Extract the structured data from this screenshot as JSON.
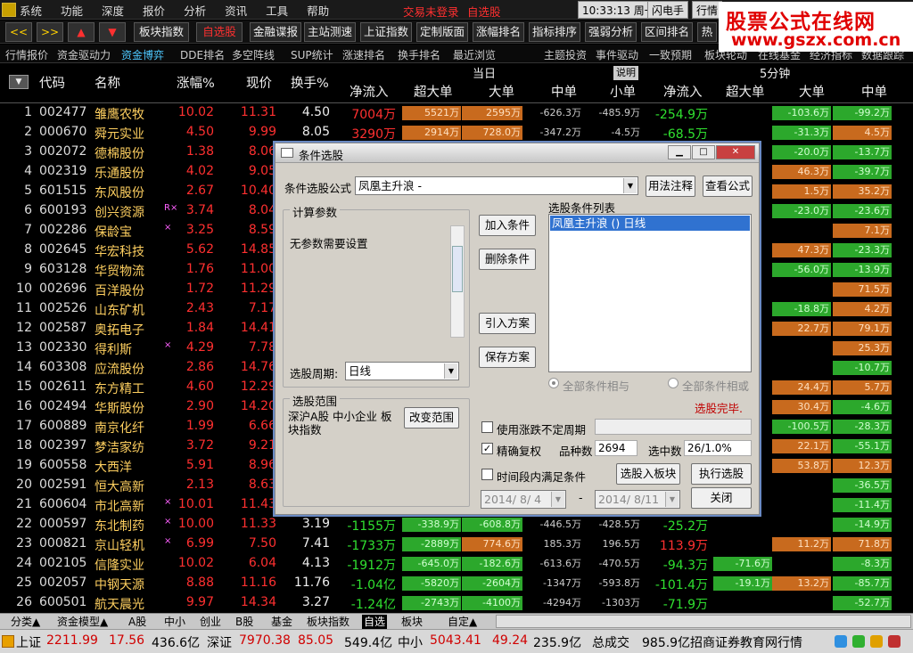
{
  "menu": [
    "系统",
    "功能",
    "深度",
    "报价",
    "分析",
    "资讯",
    "工具",
    "帮助"
  ],
  "login_status": "交易未登录",
  "my_pick": "自选股",
  "clock": "10:33:13 周一",
  "flash_label": "闪电手",
  "quote_label": "行情",
  "watermark": {
    "line1": "股票公式在线网",
    "line2": "www.gszx.com.cn"
  },
  "toolbar": {
    "nav": [
      "<<",
      ">>",
      "▲",
      "▼"
    ],
    "buttons": [
      "板块指数",
      "自选股",
      "金融谍报",
      "主站测速",
      "上证指数",
      "定制版面",
      "涨幅排名",
      "指标排序",
      "强弱分析",
      "区间排名",
      "热"
    ],
    "active": "自选股"
  },
  "subtabs": [
    "行情报价",
    "资金驱动力",
    "资金博弈",
    "DDE排名",
    "多空阵线",
    "SUP统计",
    "涨速排名",
    "换手排名",
    "最近浏览",
    "主题投资",
    "事件驱动",
    "一致预期",
    "板块轮动",
    "在线基金",
    "经济指标",
    "数据跟踪"
  ],
  "subtab_active": "资金博弈",
  "table": {
    "group_today": "当日",
    "explain": "说明",
    "group_5min": "5分钟",
    "columns": [
      "代码",
      "名称",
      "涨幅%",
      "现价",
      "换手%",
      "净流入",
      "超大单",
      "大单",
      "中单",
      "小单",
      "净流入",
      "超大单",
      "大单",
      "中单"
    ],
    "rows": [
      {
        "no": "1",
        "code": "002477",
        "name": "雏鹰农牧",
        "mark": "",
        "chg": "10.02",
        "price": "11.31",
        "turn": "4.50",
        "net": "7004万",
        "xl": "5521万",
        "xlu": true,
        "l": "2595万",
        "lu": true,
        "m": "-626.3万",
        "s": "-485.9万",
        "net5": "-254.9万",
        "net5u": false,
        "l5": "-103.6万",
        "l5u": false,
        "m5": "-99.2万",
        "m5u": false
      },
      {
        "no": "2",
        "code": "000670",
        "name": "舜元实业",
        "mark": "",
        "chg": "4.50",
        "price": "9.99",
        "turn": "8.05",
        "net": "3290万",
        "xl": "2914万",
        "xlu": true,
        "l": "728.0万",
        "lu": true,
        "m": "-347.2万",
        "s": "-4.5万",
        "net5": "-68.5万",
        "net5u": false,
        "l5": "-31.3万",
        "l5u": false,
        "m5": "4.5万",
        "m5u": true
      },
      {
        "no": "3",
        "code": "002072",
        "name": "德棉股份",
        "mark": "",
        "chg": "1.38",
        "price": "8.06",
        "turn": "",
        "net": "",
        "xl": "",
        "l": "",
        "m": "",
        "s": "",
        "net5": "",
        "l5": "-20.0万",
        "l5u": false,
        "m5": "-13.7万",
        "m5u": false
      },
      {
        "no": "4",
        "code": "002319",
        "name": "乐通股份",
        "mark": "",
        "chg": "4.02",
        "price": "9.05",
        "turn": "",
        "net": "",
        "xl": "",
        "l": "",
        "m": "",
        "s": "",
        "net5": "",
        "l5": "46.3万",
        "l5u": true,
        "m5": "-39.7万",
        "m5u": false
      },
      {
        "no": "5",
        "code": "601515",
        "name": "东风股份",
        "mark": "",
        "chg": "2.67",
        "price": "10.40",
        "turn": "",
        "net": "",
        "xl": "",
        "l": "",
        "m": "",
        "s": "",
        "net5": "",
        "l5": "1.5万",
        "l5u": true,
        "m5": "35.2万",
        "m5u": true
      },
      {
        "no": "6",
        "code": "600193",
        "name": "创兴资源",
        "mark": "R×",
        "chg": "3.74",
        "price": "8.04",
        "turn": "",
        "net": "",
        "xl": "",
        "l": "",
        "m": "",
        "s": "",
        "net5": "",
        "l5": "-23.0万",
        "l5u": false,
        "m5": "-23.6万",
        "m5u": false
      },
      {
        "no": "7",
        "code": "002286",
        "name": "保龄宝",
        "mark": "×",
        "chg": "3.25",
        "price": "8.59",
        "turn": "",
        "net": "",
        "xl": "",
        "l": "",
        "m": "",
        "s": "",
        "net5": "",
        "l5": "",
        "m5": "7.1万",
        "m5u": true
      },
      {
        "no": "8",
        "code": "002645",
        "name": "华宏科技",
        "mark": "",
        "chg": "5.62",
        "price": "14.85",
        "turn": "",
        "net": "",
        "xl": "",
        "l": "",
        "m": "",
        "s": "",
        "net5": "",
        "l5": "47.3万",
        "l5u": true,
        "m5": "-23.3万",
        "m5u": false
      },
      {
        "no": "9",
        "code": "603128",
        "name": "华贸物流",
        "mark": "",
        "chg": "1.76",
        "price": "11.00",
        "turn": "",
        "net": "",
        "xl": "",
        "l": "",
        "m": "",
        "s": "",
        "net5": "",
        "l5": "-56.0万",
        "l5u": false,
        "m5": "-13.9万",
        "m5u": false
      },
      {
        "no": "10",
        "code": "002696",
        "name": "百洋股份",
        "mark": "",
        "chg": "1.72",
        "price": "11.29",
        "turn": "",
        "net": "",
        "xl": "",
        "l": "",
        "m": "",
        "s": "",
        "net5": "",
        "l5": "",
        "m5": "71.5万",
        "m5u": true
      },
      {
        "no": "11",
        "code": "002526",
        "name": "山东矿机",
        "mark": "",
        "chg": "2.43",
        "price": "7.17",
        "turn": "",
        "net": "",
        "xl": "",
        "l": "",
        "m": "",
        "s": "",
        "net5": "",
        "l5": "-18.8万",
        "l5u": false,
        "m5": "4.2万",
        "m5u": true
      },
      {
        "no": "12",
        "code": "002587",
        "name": "奥拓电子",
        "mark": "",
        "chg": "1.84",
        "price": "14.41",
        "turn": "",
        "net": "",
        "xl": "",
        "l": "",
        "m": "",
        "s": "",
        "net5": "",
        "l5": "22.7万",
        "l5u": true,
        "m5": "79.1万",
        "m5u": true
      },
      {
        "no": "13",
        "code": "002330",
        "name": "得利斯",
        "mark": "×",
        "chg": "4.29",
        "price": "7.78",
        "turn": "",
        "net": "",
        "xl": "",
        "l": "",
        "m": "",
        "s": "",
        "net5": "",
        "l5": "",
        "m5": "25.3万",
        "m5u": true
      },
      {
        "no": "14",
        "code": "603308",
        "name": "应流股份",
        "mark": "",
        "chg": "2.86",
        "price": "14.76",
        "turn": "",
        "net": "",
        "xl": "",
        "l": "",
        "m": "",
        "s": "",
        "net5": "",
        "l5": "",
        "m5": "-10.7万",
        "m5u": false
      },
      {
        "no": "15",
        "code": "002611",
        "name": "东方精工",
        "mark": "",
        "chg": "4.60",
        "price": "12.29",
        "turn": "",
        "net": "",
        "xl": "",
        "l": "",
        "m": "",
        "s": "",
        "net5": "",
        "l5": "24.4万",
        "l5u": true,
        "m5": "5.7万",
        "m5u": true
      },
      {
        "no": "16",
        "code": "002494",
        "name": "华斯股份",
        "mark": "",
        "chg": "2.90",
        "price": "14.20",
        "turn": "",
        "net": "",
        "xl": "",
        "l": "",
        "m": "",
        "s": "",
        "net5": "",
        "l5": "30.4万",
        "l5u": true,
        "m5": "-4.6万",
        "m5u": false
      },
      {
        "no": "17",
        "code": "600889",
        "name": "南京化纤",
        "mark": "",
        "chg": "1.99",
        "price": "6.66",
        "turn": "",
        "net": "",
        "xl": "",
        "l": "",
        "m": "",
        "s": "",
        "net5": "",
        "l5": "-100.5万",
        "l5u": false,
        "m5": "-28.3万",
        "m5u": false
      },
      {
        "no": "18",
        "code": "002397",
        "name": "梦洁家纺",
        "mark": "",
        "chg": "3.72",
        "price": "9.21",
        "turn": "",
        "net": "",
        "xl": "",
        "l": "",
        "m": "",
        "s": "",
        "net5": "",
        "l5": "22.1万",
        "l5u": true,
        "m5": "-55.1万",
        "m5u": false
      },
      {
        "no": "19",
        "code": "600558",
        "name": "大西洋",
        "mark": "",
        "chg": "5.91",
        "price": "8.96",
        "turn": "",
        "net": "",
        "xl": "",
        "l": "",
        "m": "",
        "s": "",
        "net5": "",
        "l5": "53.8万",
        "l5u": true,
        "m5": "12.3万",
        "m5u": true
      },
      {
        "no": "20",
        "code": "002591",
        "name": "恒大高新",
        "mark": "",
        "chg": "2.13",
        "price": "8.63",
        "turn": "",
        "net": "",
        "xl": "",
        "l": "",
        "m": "",
        "s": "",
        "net5": "",
        "l5": "",
        "m5": "-36.5万",
        "m5u": false
      },
      {
        "no": "21",
        "code": "600604",
        "name": "市北高新",
        "mark": "×",
        "chg": "10.01",
        "price": "11.43",
        "turn": "",
        "net": "",
        "xl": "",
        "l": "",
        "m": "",
        "s": "",
        "net5": "",
        "l5": "",
        "m5": "-11.4万",
        "m5u": false
      },
      {
        "no": "22",
        "code": "000597",
        "name": "东北制药",
        "mark": "×",
        "chg": "10.00",
        "price": "11.33",
        "turn": "3.19",
        "net": "-1155万",
        "xl": "-338.9万",
        "xlu": false,
        "l": "-608.8万",
        "lu": false,
        "m": "-446.5万",
        "s": "-428.5万",
        "net5": "-25.2万",
        "net5u": false,
        "l5": "",
        "m5": "-14.9万",
        "m5u": false
      },
      {
        "no": "23",
        "code": "000821",
        "name": "京山轻机",
        "mark": "×",
        "chg": "6.99",
        "price": "7.50",
        "turn": "7.41",
        "net": "-1733万",
        "xl": "-2889万",
        "xlu": false,
        "l": "774.6万",
        "lu": true,
        "m": "185.3万",
        "s": "196.5万",
        "net5": "113.9万",
        "net5u": true,
        "l5": "11.2万",
        "l5u": true,
        "m5": "71.8万",
        "m5u": true
      },
      {
        "no": "24",
        "code": "002105",
        "name": "信隆实业",
        "mark": "",
        "chg": "10.02",
        "price": "6.04",
        "turn": "4.13",
        "net": "-1912万",
        "xl": "-645.0万",
        "xlu": false,
        "l": "-182.6万",
        "lu": false,
        "m": "-613.6万",
        "s": "-470.5万",
        "net5": "-94.3万",
        "net5u": false,
        "x5": "-71.6万",
        "l5": "",
        "m5": "-8.3万",
        "m5u": false
      },
      {
        "no": "25",
        "code": "002057",
        "name": "中钢天源",
        "mark": "",
        "chg": "8.88",
        "price": "11.16",
        "turn": "11.76",
        "net": "-1.04亿",
        "xl": "-5820万",
        "xlu": false,
        "l": "-2604万",
        "lu": false,
        "m": "-1347万",
        "s": "-593.8万",
        "net5": "-101.4万",
        "net5u": false,
        "x5": "-19.1万",
        "l5": "13.2万",
        "l5u": true,
        "m5": "-85.7万",
        "m5u": false
      },
      {
        "no": "26",
        "code": "600501",
        "name": "航天晨光",
        "mark": "",
        "chg": "9.97",
        "price": "14.34",
        "turn": "3.27",
        "net": "-1.24亿",
        "xl": "-2743万",
        "xlu": false,
        "l": "-4100万",
        "lu": false,
        "m": "-4294万",
        "s": "-1303万",
        "net5": "-71.9万",
        "net5u": false,
        "l5": "",
        "m5": "-52.7万",
        "m5u": false
      }
    ]
  },
  "bottom_tabs": [
    "分类▲",
    "资金模型▲",
    "A股",
    "中小",
    "创业",
    "B股",
    "基金",
    "板块指数",
    "自选",
    "板块",
    "自定▲"
  ],
  "bottom_active": "自选",
  "status": {
    "sh_label": "上证",
    "sh_val": "2211.99",
    "sh_chg": "17.56",
    "sh_amt": "436.6亿",
    "sz_label": "深证",
    "sz_val": "7970.38",
    "sz_chg": "85.05",
    "sz_amt": "549.4亿",
    "zx_label": "中小",
    "zx_val": "5043.41",
    "zx_chg": "49.24",
    "zx_amt": "235.9亿",
    "total_label": "总成交",
    "total_amt": "985.9亿",
    "broker": "招商证券教育网行情"
  },
  "dialog": {
    "title": "条件选股",
    "formula_label": "条件选股公式",
    "formula_value": "凤凰主升浪 -",
    "usage_btn": "用法注释",
    "view_btn": "查看公式",
    "calc_group": "计算参数",
    "no_param": "无参数需要设置",
    "period_label": "选股周期:",
    "period_value": "日线",
    "add_btn": "加入条件",
    "del_btn": "删除条件",
    "import_btn": "引入方案",
    "save_btn": "保存方案",
    "list_label": "选股条件列表",
    "list_item": "凤凰主升浪 () 日线",
    "radio_and": "全部条件相与",
    "radio_or": "全部条件相或",
    "done": "选股完毕.",
    "range_group": "选股范围",
    "range_text": "深沪A股 中小企业 板块指数",
    "change_range_btn": "改变范围",
    "uncertain_label": "使用涨跌不定周期",
    "exact_label": "精确复权",
    "count_label": "品种数",
    "count_value": "2694",
    "selected_label": "选中数",
    "selected_value": "26/1.0%",
    "period_meet_label": "时间段内满足条件",
    "to_board_btn": "选股入板块",
    "run_btn": "执行选股",
    "date_from": "2014/ 8/ 4",
    "date_sep": "-",
    "date_to": "2014/ 8/11",
    "close_btn": "关闭"
  }
}
